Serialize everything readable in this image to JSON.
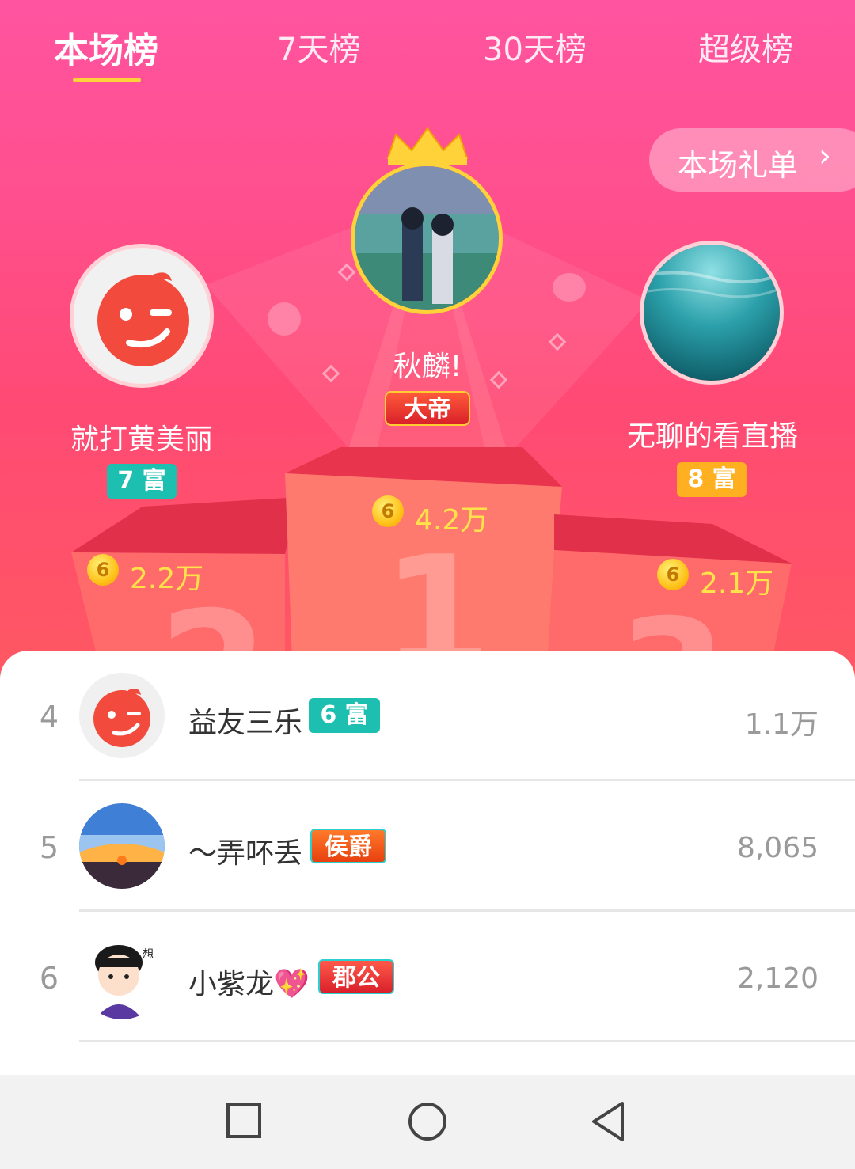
{
  "tabs": [
    {
      "label": "本场榜",
      "active": true
    },
    {
      "label": "7天榜"
    },
    {
      "label": "30天榜"
    },
    {
      "label": "超级榜"
    }
  ],
  "gift_button": {
    "label": "本场礼单",
    "chevron": "›"
  },
  "podium": {
    "first": {
      "name": "秋麟!",
      "title_badge": "大帝",
      "amount": "4.2万",
      "number": "1"
    },
    "second": {
      "name": "就打黄美丽",
      "rich_level": "7 富",
      "amount": "2.2万",
      "number": "2"
    },
    "third": {
      "name": "无聊的看直播",
      "rich_level": "8 富",
      "amount": "2.1万",
      "number": "3"
    }
  },
  "coin_label": "6",
  "list": [
    {
      "rank": "4",
      "name": "益友三乐",
      "badge": "6 富",
      "badge_type": "rich",
      "value": "1.1万"
    },
    {
      "rank": "5",
      "name": "～弄吥丢",
      "badge": "侯爵",
      "badge_type": "noble",
      "value": "8,065"
    },
    {
      "rank": "6",
      "name": "小紫龙💖",
      "badge": "郡公",
      "badge_type": "noble",
      "value": "2,120"
    }
  ],
  "colors": {
    "accent_pink": "#ff4f8d",
    "rich_teal": "#1dbfb0",
    "rich_orange": "#ffb020",
    "gold": "#ffe14a"
  }
}
